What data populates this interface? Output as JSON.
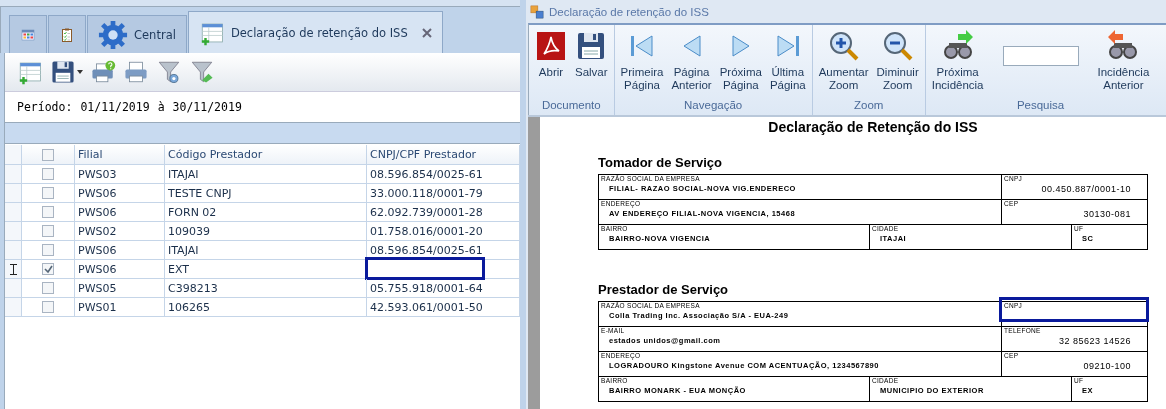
{
  "left": {
    "tabs": [
      {
        "kind": "calendar",
        "selected": false
      },
      {
        "kind": "checklist",
        "selected": false
      },
      {
        "kind": "gear",
        "label": "Central",
        "selected": false
      },
      {
        "kind": "document",
        "label": "Declaração de retenção do ISS",
        "selected": true,
        "closable": true
      }
    ],
    "toolbar": [
      {
        "kind": "new"
      },
      {
        "kind": "save",
        "dropdown": true
      },
      {
        "kind": "print-help"
      },
      {
        "kind": "print"
      },
      {
        "kind": "filter-gear"
      },
      {
        "kind": "filter-clear"
      }
    ],
    "period": {
      "label": "Período:",
      "from": "01/11/2019",
      "separator": "à",
      "to": "30/11/2019"
    },
    "grid": {
      "header_checked": false,
      "columns": [
        "Filial",
        "Código Prestador",
        "CNPJ/CPF Prestador"
      ],
      "rows": [
        {
          "filial": "PWS03",
          "codigo": "ITAJAI",
          "cnpj": "08.596.854/0025-61",
          "checked": false,
          "current": false,
          "highlighted": false
        },
        {
          "filial": "PWS06",
          "codigo": "TESTE CNPJ",
          "cnpj": "33.000.118/0001-79",
          "checked": false,
          "current": false,
          "highlighted": false
        },
        {
          "filial": "PWS06",
          "codigo": "FORN 02",
          "cnpj": "62.092.739/0001-28",
          "checked": false,
          "current": false,
          "highlighted": false
        },
        {
          "filial": "PWS02",
          "codigo": "109039",
          "cnpj": "01.758.016/0001-20",
          "checked": false,
          "current": false,
          "highlighted": false
        },
        {
          "filial": "PWS06",
          "codigo": "ITAJAI",
          "cnpj": "08.596.854/0025-61",
          "checked": false,
          "current": false,
          "highlighted": false
        },
        {
          "filial": "PWS06",
          "codigo": "EXT",
          "checked": true,
          "current": true,
          "highlighted": true
        },
        {
          "filial": "PWS05",
          "codigo": "C398213",
          "cnpj": "05.755.918/0001-64",
          "checked": false,
          "current": false,
          "highlighted": false
        },
        {
          "filial": "PWS01",
          "codigo": "106265",
          "cnpj": "42.593.061/0001-50",
          "checked": false,
          "current": false,
          "highlighted": false
        }
      ]
    }
  },
  "viewer": {
    "title": "Declaração de retenção do ISS",
    "ribbon": [
      {
        "label": "Documento",
        "items": [
          {
            "kind": "pdf",
            "label": "Abrir"
          },
          {
            "kind": "save",
            "label": "Salvar"
          }
        ]
      },
      {
        "label": "Navegação",
        "items": [
          {
            "kind": "first",
            "label": "Primeira\nPágina"
          },
          {
            "kind": "prev",
            "label": "Página\nAnterior"
          },
          {
            "kind": "next",
            "label": "Próxima\nPágina"
          },
          {
            "kind": "last",
            "label": "Última\nPágina"
          }
        ]
      },
      {
        "label": "Zoom",
        "items": [
          {
            "kind": "zoom-in",
            "label": "Aumentar\nZoom"
          },
          {
            "kind": "zoom-out",
            "label": "Diminuir\nZoom"
          }
        ]
      },
      {
        "label": "Pesquisa",
        "items": [
          {
            "kind": "find-next",
            "label": "Próxima\nIncidência"
          },
          {
            "kind": "field"
          },
          {
            "kind": "find-prev",
            "label": "Incidência\nAnterior"
          }
        ]
      }
    ],
    "document": {
      "title": "Declaração de Retenção do ISS",
      "sections": [
        {
          "title": "Tomador de Serviço",
          "rows": [
            [
              {
                "label": "RAZÃO SOCIAL DA EMPRESA",
                "value": "FILIAL- RAZAO SOCIAL-NOVA VIG.ENDERECO",
                "highlighted": false
              },
              {
                "label": "CNPJ",
                "value": "00.450.887/0001-10",
                "highlighted": false
              }
            ],
            [
              {
                "label": "ENDEREÇO",
                "value": "AV ENDEREÇO FILIAL-NOVA VIGENCIA, 15468",
                "highlighted": false
              },
              {
                "label": "CEP",
                "value": "30130-081",
                "highlighted": false
              }
            ],
            [
              {
                "label": "BAIRRO",
                "value": "BAIRRO-NOVA VIGENCIA",
                "highlighted": false
              },
              {
                "label": "CIDADE",
                "value": "ITAJAI",
                "highlighted": false
              },
              {
                "label": "UF",
                "value": "SC",
                "highlighted": false
              }
            ]
          ]
        },
        {
          "title": "Prestador de Serviço",
          "rows": [
            [
              {
                "label": "RAZÃO SOCIAL DA EMPRESA",
                "value": "Colla Trading Inc. Associação S/A - EUA-249",
                "highlighted": false
              },
              {
                "label": "CNPJ",
                "highlighted": true
              }
            ],
            [
              {
                "label": "E-MAIL",
                "value": "estados unidos@gmail.com",
                "highlighted": false
              },
              {
                "label": "TELEFONE",
                "value": "32 85623 14526",
                "highlighted": false
              }
            ],
            [
              {
                "label": "ENDEREÇO",
                "value": "LOGRADOURO Kingstone Avenue COM ACENTUAÇÃO, 1234567890",
                "highlighted": false
              },
              {
                "label": "CEP",
                "value": "09210-100",
                "highlighted": false
              }
            ],
            [
              {
                "label": "BAIRRO",
                "value": "BAIRRO MONARK - EUA MONÇÃO",
                "highlighted": false
              },
              {
                "label": "CIDADE",
                "value": "MUNICIPIO DO EXTERIOR",
                "highlighted": false
              },
              {
                "label": "UF",
                "value": "EX",
                "highlighted": false
              }
            ]
          ]
        }
      ]
    }
  }
}
